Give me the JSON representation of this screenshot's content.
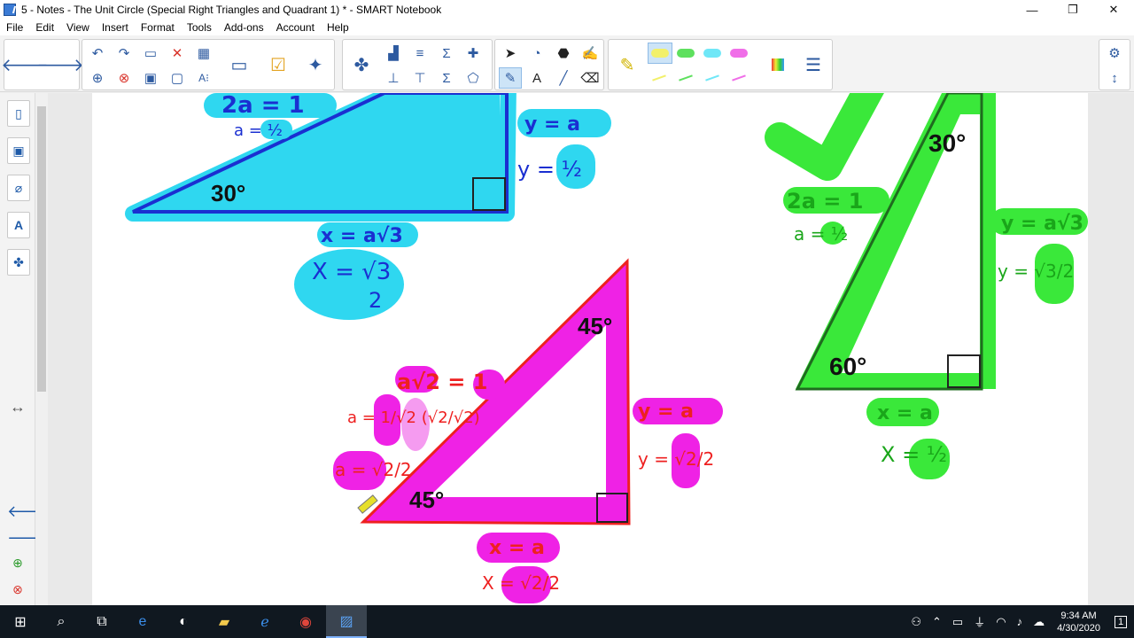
{
  "window": {
    "title": "5 - Notes -  The Unit Circle (Special Right Triangles and Quadrant 1) * - SMART Notebook",
    "minimize": "—",
    "maximize": "❐",
    "close": "✕"
  },
  "menu": [
    "File",
    "Edit",
    "View",
    "Insert",
    "Format",
    "Tools",
    "Add-ons",
    "Account",
    "Help"
  ],
  "canvas": {
    "blue_triangle": {
      "hyp_eq": "2a = 1",
      "a_val": "a = ½",
      "angle": "30°",
      "y_eq": "y = a",
      "y_val": "y = ½",
      "x_eq": "x = a√3",
      "x_val": "X = √3",
      "x_den": "2"
    },
    "pink_triangle": {
      "hyp_eq": "a√2 = 1",
      "a_frac": "a = 1/√2 (√2/√2)",
      "a_val": "a = √2/2",
      "angle_top": "45°",
      "angle_bottom": "45°",
      "y_eq": "y = a",
      "y_val": "y = √2/2",
      "x_eq": "x = a",
      "x_val": "X = √2/2"
    },
    "green_triangle": {
      "angle_top": "30°",
      "angle_bottom": "60°",
      "hyp_eq": "2a = 1",
      "a_val": "a = ½",
      "y_eq": "y = a√3",
      "y_val": "y = √3/2",
      "x_eq": "x = a",
      "x_val": "X = ½"
    }
  },
  "taskbar": {
    "time": "9:34 AM",
    "date": "4/30/2020",
    "notifications": "1"
  },
  "colors": {
    "cyan": "#2fd7f0",
    "magenta": "#ef22e5",
    "green": "#3ae83a",
    "blue_ink": "#1a2fd1",
    "red_ink": "#ee2020",
    "green_ink": "#1aa61a"
  }
}
